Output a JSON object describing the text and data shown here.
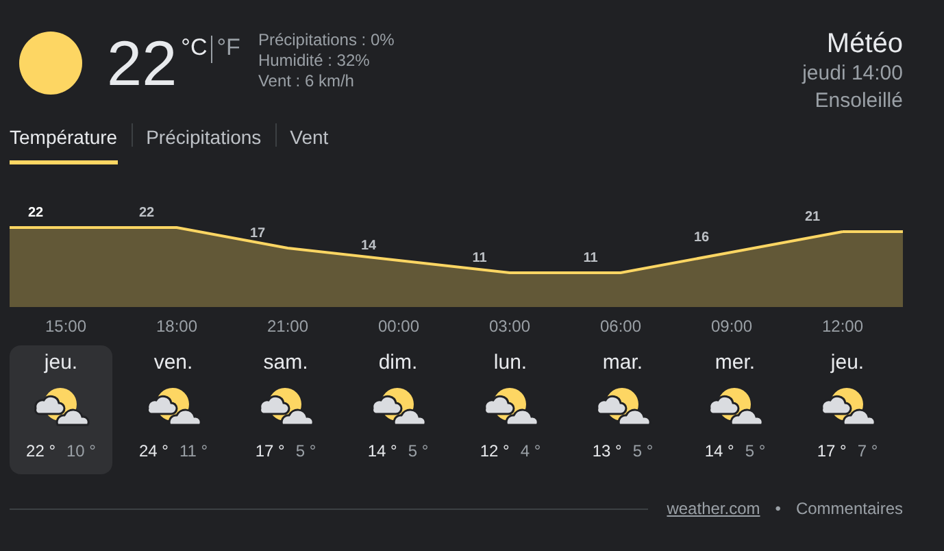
{
  "current": {
    "temperature": "22",
    "units": [
      {
        "label": "°C",
        "selected": true
      },
      {
        "label": "°F",
        "selected": false
      }
    ],
    "details": [
      "Précipitations : 0%",
      "Humidité : 32%",
      "Vent : 6 km/h"
    ]
  },
  "header": {
    "title": "Météo",
    "time": "jeudi 14:00",
    "condition": "Ensoleillé"
  },
  "tabs": [
    {
      "label": "Température",
      "selected": true
    },
    {
      "label": "Précipitations",
      "selected": false
    },
    {
      "label": "Vent",
      "selected": false
    }
  ],
  "chart": {
    "chart_data": {
      "type": "area",
      "categories": [
        "15:00",
        "18:00",
        "21:00",
        "00:00",
        "03:00",
        "06:00",
        "09:00",
        "12:00"
      ],
      "series": [
        {
          "color": "#fdd663",
          "values": [
            22,
            22,
            17,
            14,
            11,
            11,
            16,
            21
          ]
        }
      ],
      "data_labels": true
    }
  },
  "days": [
    {
      "name": "jeu.",
      "high": "22 °",
      "low": "10 °",
      "selected": true
    },
    {
      "name": "ven.",
      "high": "24 °",
      "low": "11 °",
      "selected": false
    },
    {
      "name": "sam.",
      "high": "17 °",
      "low": "5 °",
      "selected": false
    },
    {
      "name": "dim.",
      "high": "14 °",
      "low": "5 °",
      "selected": false
    },
    {
      "name": "lun.",
      "high": "12 °",
      "low": "4 °",
      "selected": false
    },
    {
      "name": "mar.",
      "high": "13 °",
      "low": "5 °",
      "selected": false
    },
    {
      "name": "mer.",
      "high": "14 °",
      "low": "5 °",
      "selected": false
    },
    {
      "name": "jeu.",
      "high": "17 °",
      "low": "7 °",
      "selected": false
    }
  ],
  "footer": {
    "source": "weather.com",
    "separator": "•",
    "feedback": "Commentaires"
  }
}
